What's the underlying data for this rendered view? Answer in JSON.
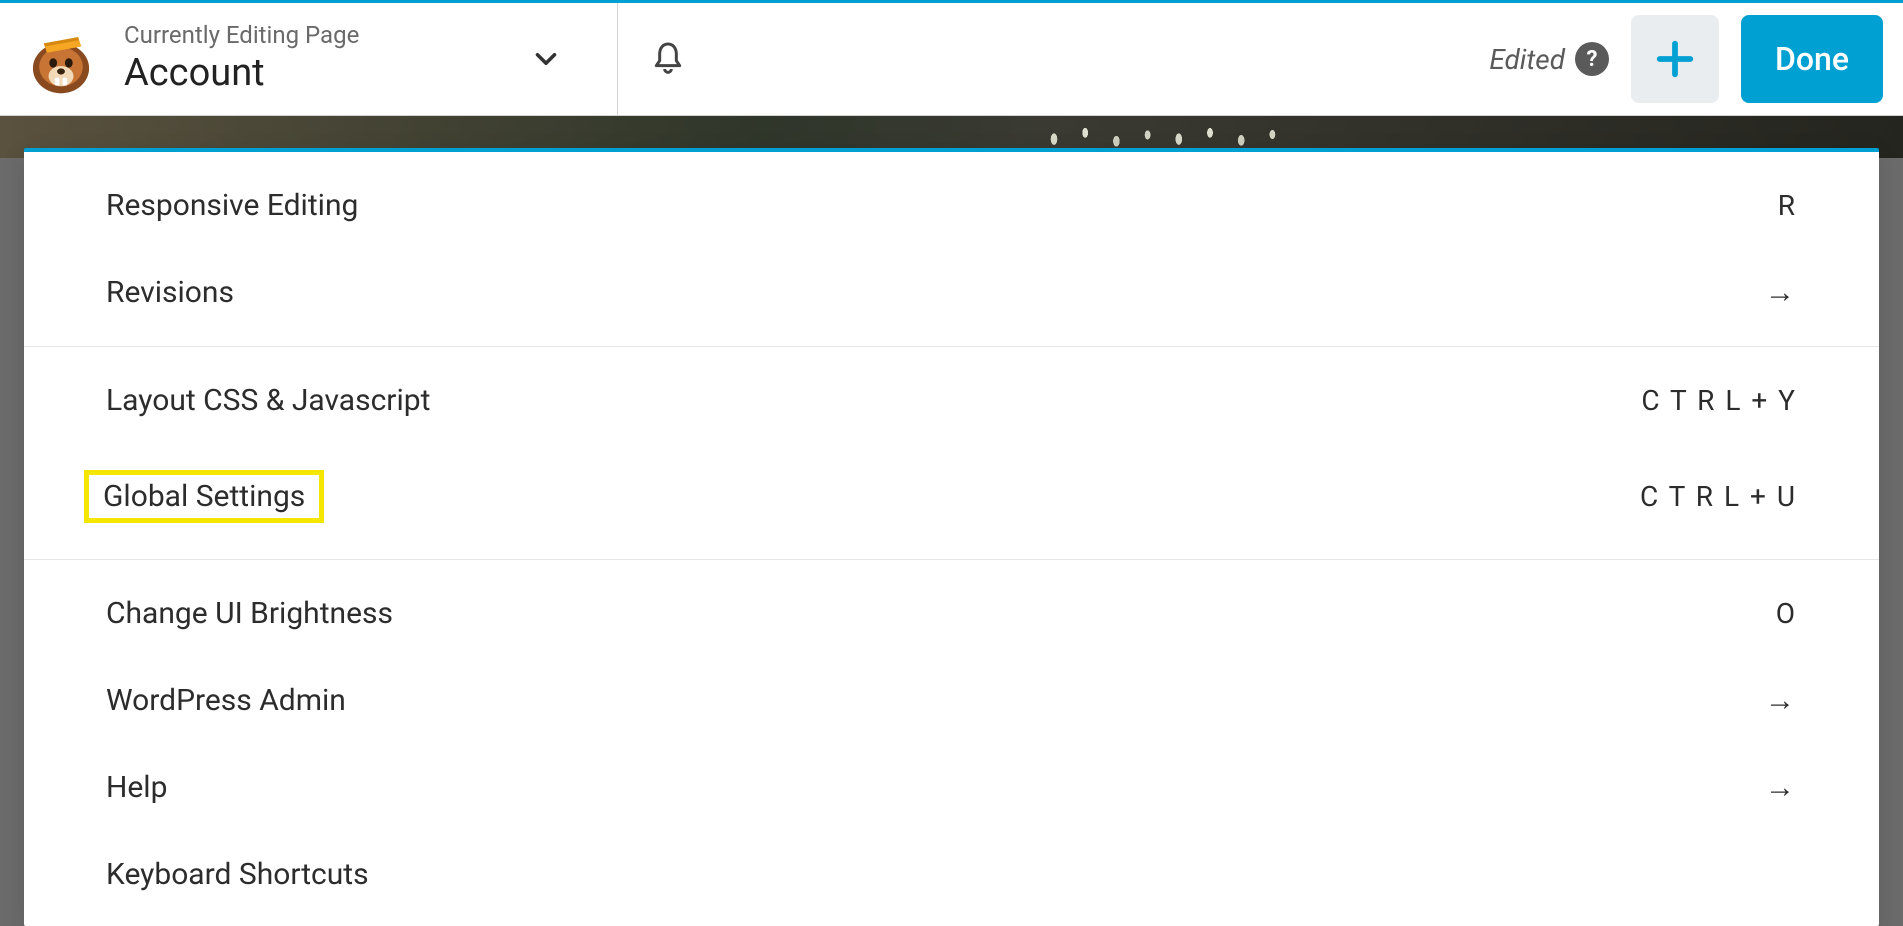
{
  "header": {
    "subtitle": "Currently Editing Page",
    "page_name": "Account",
    "edited_label": "Edited",
    "done_label": "Done"
  },
  "menu": {
    "section1": [
      {
        "label": "Responsive Editing",
        "shortcut": "R",
        "type": "key"
      },
      {
        "label": "Revisions",
        "shortcut": "→",
        "type": "arrow"
      }
    ],
    "section2": [
      {
        "label": "Layout CSS & Javascript",
        "shortcut": "C T R L + Y",
        "type": "key"
      },
      {
        "label": "Global Settings",
        "shortcut": "C T R L + U",
        "type": "key",
        "highlighted": true
      }
    ],
    "section3": [
      {
        "label": "Change UI Brightness",
        "shortcut": "O",
        "type": "key"
      },
      {
        "label": "WordPress Admin",
        "shortcut": "→",
        "type": "arrow"
      },
      {
        "label": "Help",
        "shortcut": "→",
        "type": "arrow"
      },
      {
        "label": "Keyboard Shortcuts",
        "shortcut": "",
        "type": "key"
      }
    ]
  },
  "colors": {
    "accent": "#00a0d2",
    "highlight": "#f3e600"
  }
}
